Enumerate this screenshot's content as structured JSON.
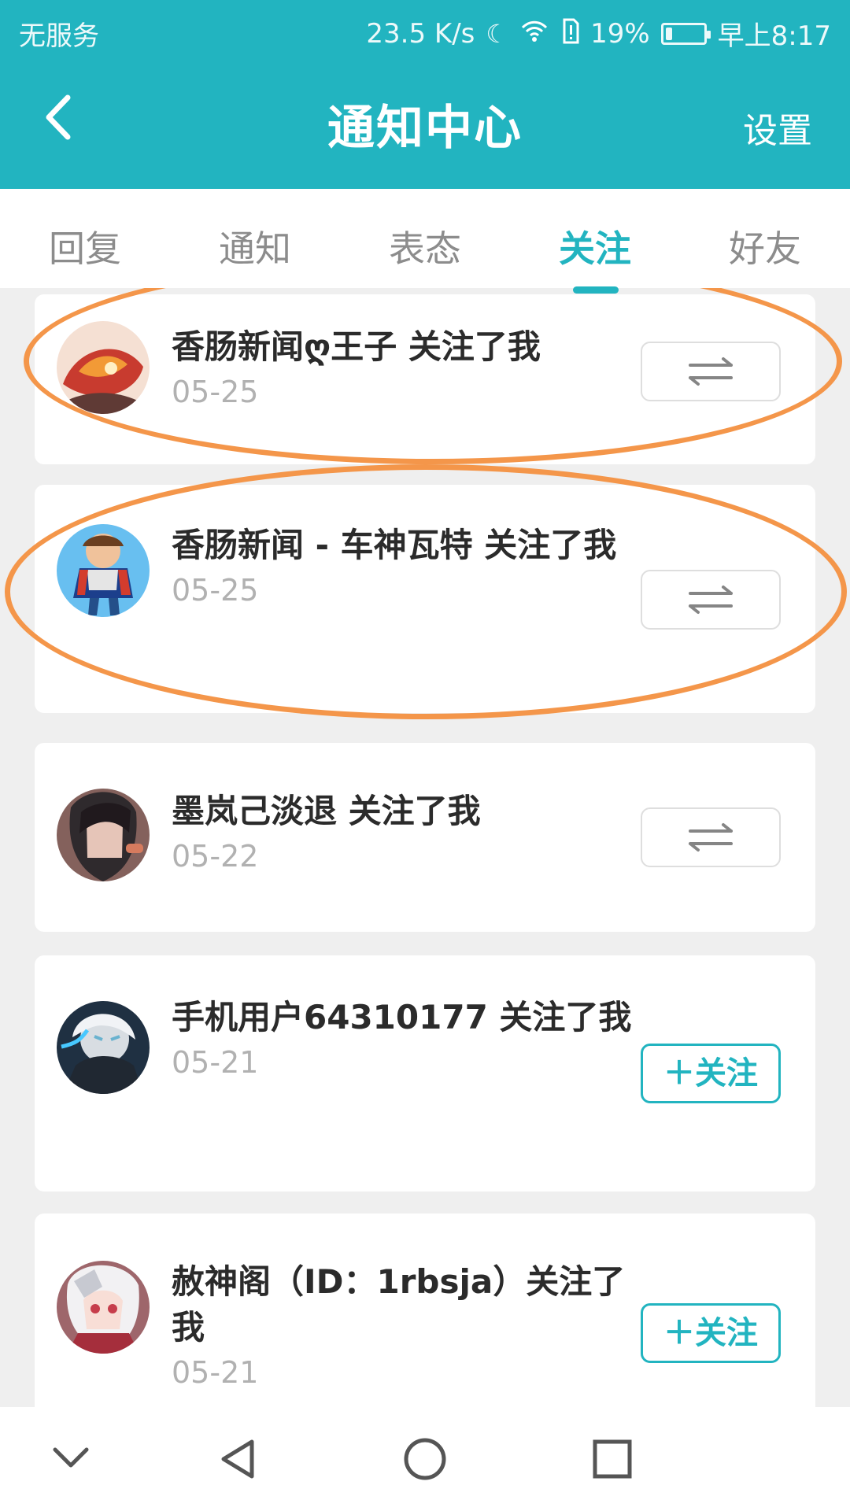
{
  "status_bar": {
    "network_text": "无服务",
    "speed": "23.5 K/s",
    "battery": "19%",
    "battery_level": 0.19,
    "time": "早上8:17"
  },
  "header": {
    "title": "通知中心",
    "settings_label": "设置"
  },
  "tabs": [
    {
      "label": "回复"
    },
    {
      "label": "通知"
    },
    {
      "label": "表态"
    },
    {
      "label": "关注"
    },
    {
      "label": "好友"
    }
  ],
  "notifications": [
    {
      "message": "香肠新闻ღ王子 关注了我",
      "date": "05-25",
      "action": "mutual"
    },
    {
      "message": "香肠新闻 - 车神瓦特 关注了我",
      "date": "05-25",
      "action": "mutual"
    },
    {
      "message": "墨岚己淡退 关注了我",
      "date": "05-22",
      "action": "mutual"
    },
    {
      "message": "手机用户64310177 关注了我",
      "date": "05-21",
      "action": "follow",
      "action_label": "关注"
    },
    {
      "message": "赦神阁（ID：1rbsja）关注了我",
      "date": "05-21",
      "action": "follow",
      "action_label": "关注"
    }
  ],
  "colors": {
    "accent": "#22b4c0",
    "annotation": "#f4964a"
  }
}
